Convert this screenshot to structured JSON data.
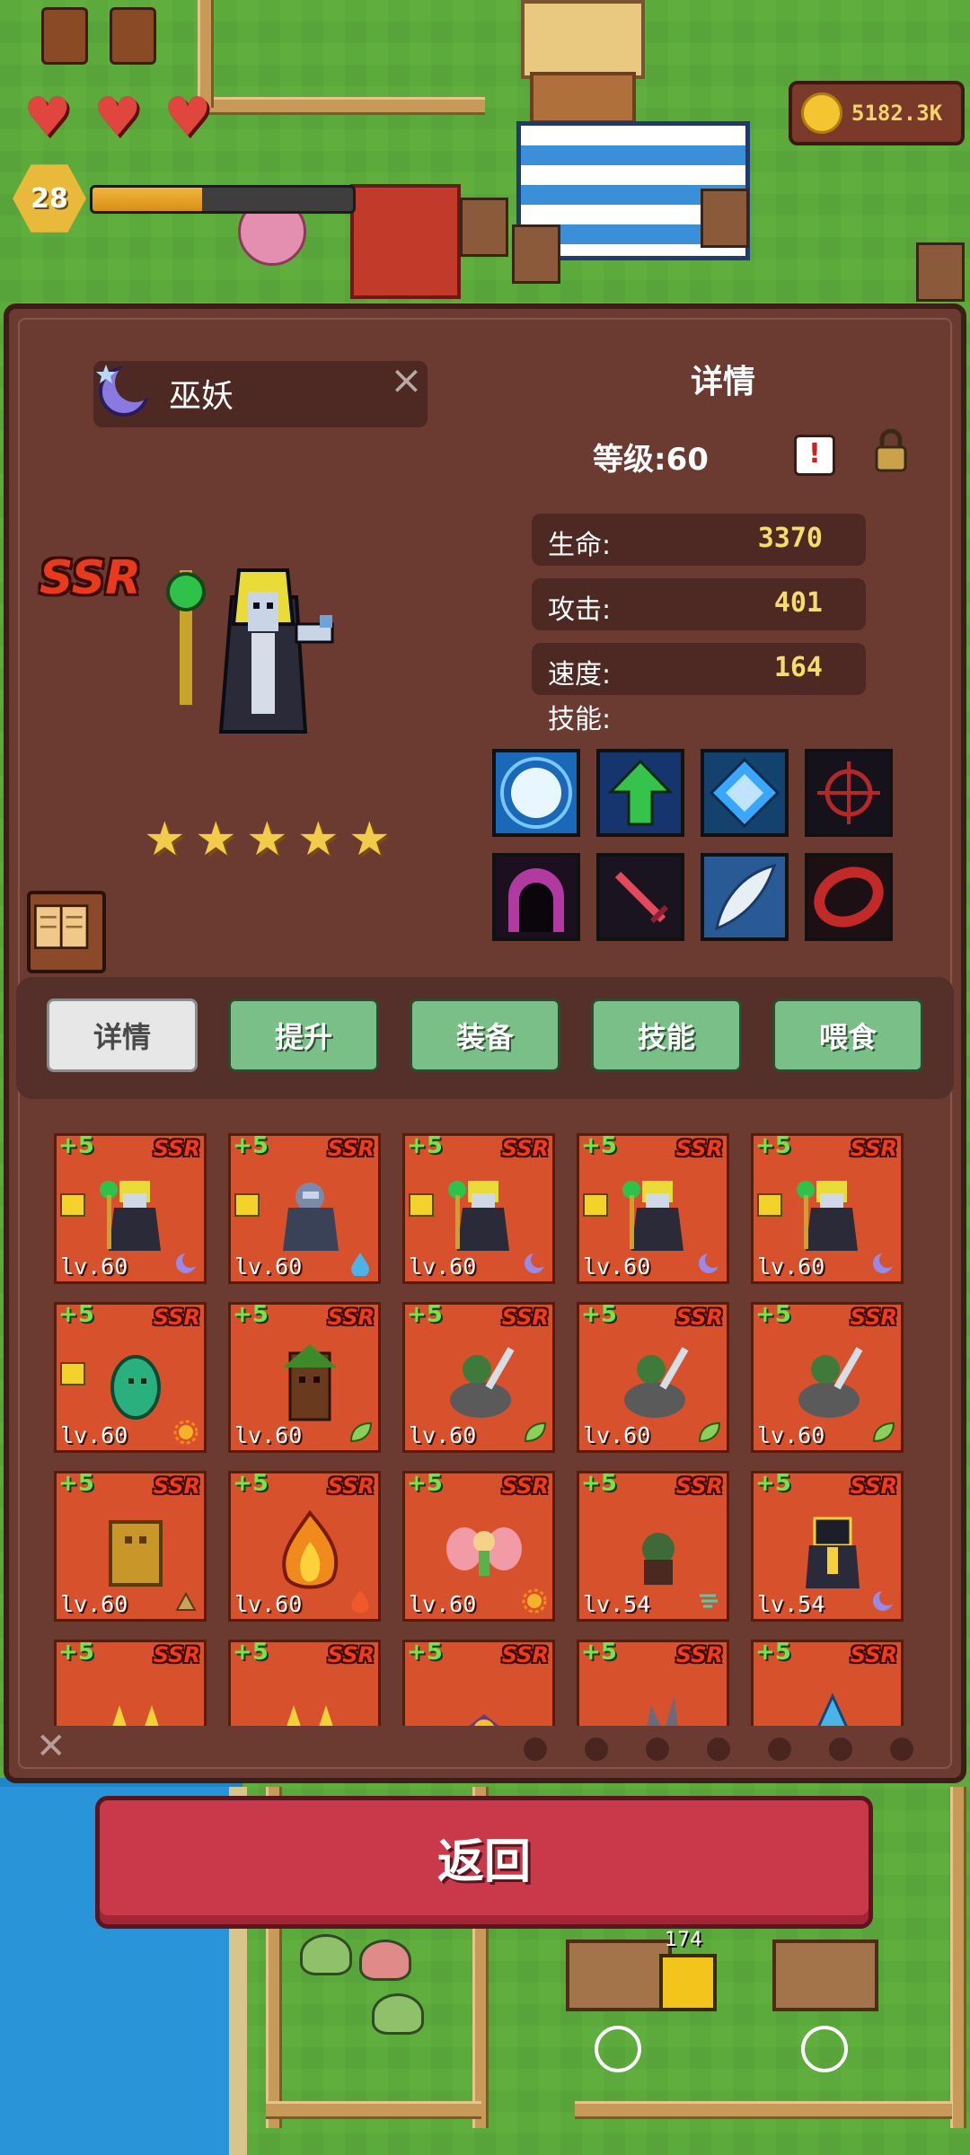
{
  "hud": {
    "gold": "5182.3K",
    "player_level": "28",
    "xp_progress": 0.42,
    "hearts": 3
  },
  "panel": {
    "unit_name": "巫妖",
    "detail_title": "详情",
    "level": "等级:60",
    "rarity": "SSR",
    "stars": 5,
    "stats": [
      {
        "label": "生命:",
        "value": "3370"
      },
      {
        "label": "攻击:",
        "value": "401"
      },
      {
        "label": "速度:",
        "value": "164"
      }
    ],
    "skills_label": "技能:",
    "skills": [
      {
        "icon": "light-burst-icon",
        "bg": "#1b67b8",
        "fg": "#e8f6ff"
      },
      {
        "icon": "up-arrow-icon",
        "bg": "#16356e",
        "fg": "#35c34b"
      },
      {
        "icon": "diamond-icon",
        "bg": "#14426e",
        "fg": "#39a7ff"
      },
      {
        "icon": "crosshair-icon",
        "bg": "#16121c",
        "fg": "#b32828"
      },
      {
        "icon": "dark-portal-icon",
        "bg": "#1c1020",
        "fg": "#b03aa0"
      },
      {
        "icon": "sword-icon",
        "bg": "#1a1420",
        "fg": "#e04a5a"
      },
      {
        "icon": "feather-icon",
        "bg": "#2a5a96",
        "fg": "#e8eef6"
      },
      {
        "icon": "red-ring-icon",
        "bg": "#1c1014",
        "fg": "#c22a2a"
      }
    ],
    "tabs": [
      "详情",
      "提升",
      "装备",
      "技能",
      "喂食"
    ],
    "active_tab": 0
  },
  "units": [
    {
      "plus": "+5",
      "rarity": "SSR",
      "level": "lv.60",
      "sprite": "lich",
      "element": "moon",
      "flag": true
    },
    {
      "plus": "+5",
      "rarity": "SSR",
      "level": "lv.60",
      "sprite": "frost-knight",
      "element": "water",
      "flag": true
    },
    {
      "plus": "+5",
      "rarity": "SSR",
      "level": "lv.60",
      "sprite": "lich",
      "element": "moon",
      "flag": true
    },
    {
      "plus": "+5",
      "rarity": "SSR",
      "level": "lv.60",
      "sprite": "lich",
      "element": "moon",
      "flag": true
    },
    {
      "plus": "+5",
      "rarity": "SSR",
      "level": "lv.60",
      "sprite": "lich",
      "element": "moon",
      "flag": true
    },
    {
      "plus": "+5",
      "rarity": "SSR",
      "level": "lv.60",
      "sprite": "slime-spirit",
      "element": "sun",
      "flag": true
    },
    {
      "plus": "+5",
      "rarity": "SSR",
      "level": "lv.60",
      "sprite": "treant",
      "element": "leaf",
      "flag": false
    },
    {
      "plus": "+5",
      "rarity": "SSR",
      "level": "lv.60",
      "sprite": "orc-rider",
      "element": "leaf",
      "flag": false
    },
    {
      "plus": "+5",
      "rarity": "SSR",
      "level": "lv.60",
      "sprite": "orc-rider",
      "element": "leaf",
      "flag": false
    },
    {
      "plus": "+5",
      "rarity": "SSR",
      "level": "lv.60",
      "sprite": "orc-rider",
      "element": "leaf",
      "flag": false
    },
    {
      "plus": "+5",
      "rarity": "SSR",
      "level": "lv.60",
      "sprite": "golem",
      "element": "earth",
      "flag": false
    },
    {
      "plus": "+5",
      "rarity": "SSR",
      "level": "lv.60",
      "sprite": "fire-elemental",
      "element": "fire",
      "flag": false
    },
    {
      "plus": "+5",
      "rarity": "SSR",
      "level": "lv.60",
      "sprite": "fairy",
      "element": "sun",
      "flag": false
    },
    {
      "plus": "+5",
      "rarity": "SSR",
      "level": "lv.54",
      "sprite": "goblin",
      "element": "wind",
      "flag": false
    },
    {
      "plus": "+5",
      "rarity": "SSR",
      "level": "lv.54",
      "sprite": "dark-knight",
      "element": "moon",
      "flag": false
    },
    {
      "plus": "+5",
      "rarity": "SSR",
      "level": "",
      "sprite": "horned",
      "element": "",
      "flag": false
    },
    {
      "plus": "+5",
      "rarity": "SSR",
      "level": "",
      "sprite": "horned",
      "element": "",
      "flag": false
    },
    {
      "plus": "+5",
      "rarity": "SSR",
      "level": "",
      "sprite": "bat",
      "element": "",
      "flag": false
    },
    {
      "plus": "+5",
      "rarity": "SSR",
      "level": "",
      "sprite": "wolf",
      "element": "",
      "flag": false
    },
    {
      "plus": "+5",
      "rarity": "SSR",
      "level": "",
      "sprite": "water-slime",
      "element": "",
      "flag": false
    }
  ],
  "filters": [
    "fire-filter-icon",
    "earth-filter-icon",
    "water-filter-icon",
    "wind-filter-icon",
    "flame-filter-icon",
    "sun-filter-icon",
    "moon-filter-icon"
  ],
  "return_label": "返回",
  "bottom_count": "174",
  "colors": {
    "panel": "#6b3a30",
    "card": "#d7522c",
    "tab": "#79bf87",
    "return_button": "#c9394a",
    "stat_value": "#f6dc6a"
  }
}
